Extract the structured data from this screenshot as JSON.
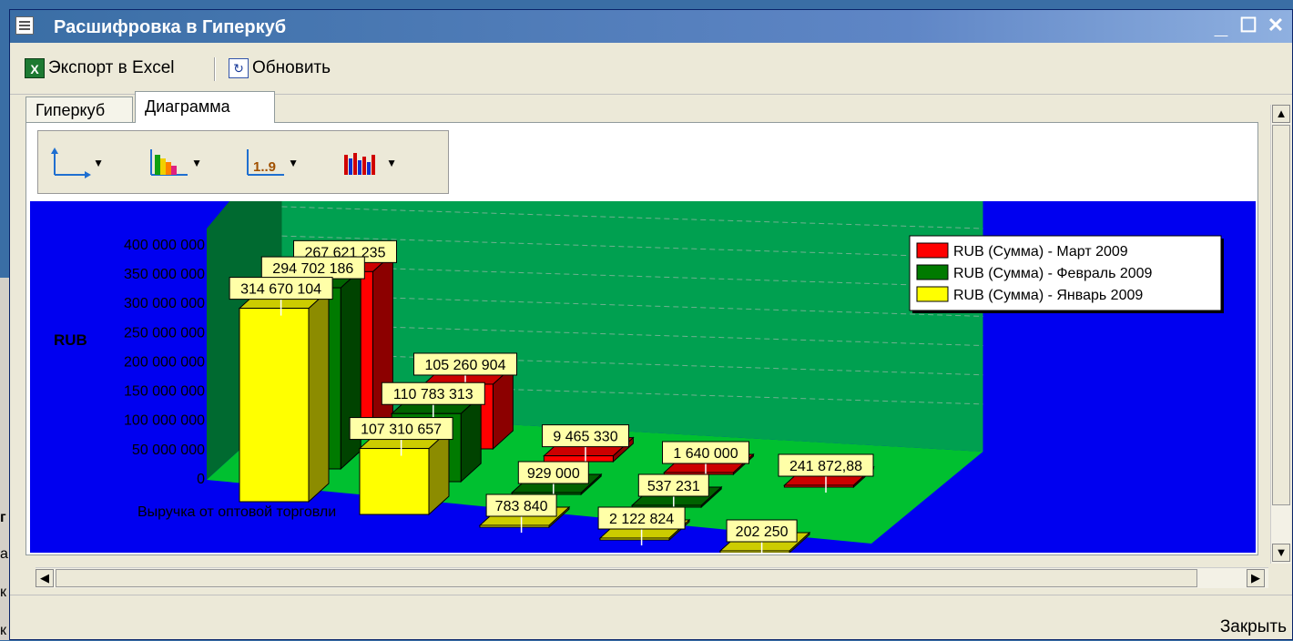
{
  "window": {
    "title": "Расшифровка в Гиперкуб",
    "minimize": "_",
    "maximize": "☐",
    "close": "✕"
  },
  "toolbar": {
    "export_label": "Экспорт в Excel",
    "refresh_label": "Обновить"
  },
  "tabs": [
    {
      "label": "Гиперкуб",
      "active": false
    },
    {
      "label": "Диаграмма",
      "active": true
    }
  ],
  "chart_tools": [
    "axes-icon",
    "palette-icon",
    "numbering-icon",
    "chart-type-icon"
  ],
  "footer": {
    "close_label": "Закрыть"
  },
  "desktop_fragments": [
    "г",
    "а",
    "к",
    "к"
  ],
  "chart_data": {
    "type": "bar",
    "ylabel": "RUB",
    "ytick_labels": [
      "0",
      "50 000 000",
      "100 000 000",
      "150 000 000",
      "200 000 000",
      "250 000 000",
      "300 000 000",
      "350 000 000",
      "400 000 000"
    ],
    "category_labels": [
      "Выручка от оптовой торговли"
    ],
    "ylim": [
      0,
      400000000
    ],
    "series": [
      {
        "name": "RUB (Сумма) - Март 2009",
        "color": "#ff0000",
        "labels": [
          "267 621 235",
          "105 260 904",
          "9 465 330",
          "1 640 000",
          "241 872,88"
        ],
        "values": [
          267621235,
          105260904,
          9465330,
          1640000,
          241872.88
        ]
      },
      {
        "name": "RUB (Сумма) - Февраль 2009",
        "color": "#007a00",
        "labels": [
          "294 702 186",
          "110 783 313",
          "929 000",
          "537 231",
          ""
        ],
        "values": [
          294702186,
          110783313,
          929000,
          537231,
          null
        ]
      },
      {
        "name": "RUB (Сумма) - Январь 2009",
        "color": "#ffff00",
        "labels": [
          "314 670 104",
          "107 310 657",
          "783 840",
          "2 122 824",
          "202 250"
        ],
        "values": [
          314670104,
          107310657,
          783840,
          2122824,
          202250
        ]
      }
    ],
    "legend_position": "right",
    "background": "#0000f0",
    "wall_color": "#00a050"
  }
}
